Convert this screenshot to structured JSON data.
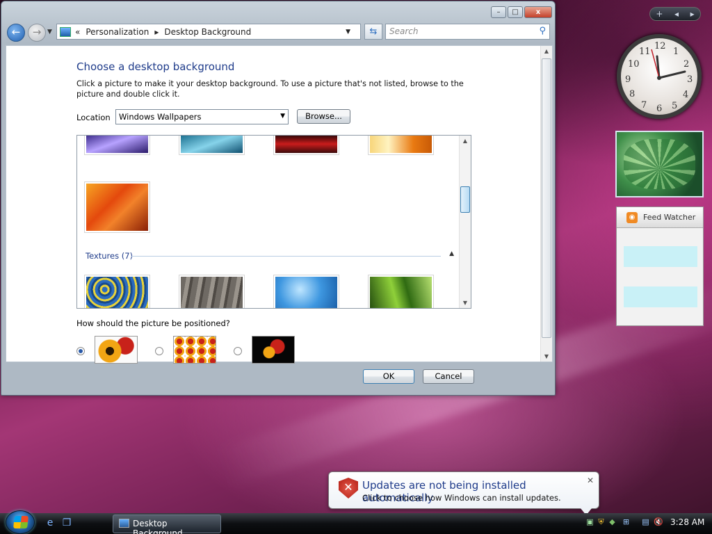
{
  "window": {
    "breadcrumb": [
      "Personalization",
      "Desktop Background"
    ],
    "breadcrumb_prefix": "«",
    "breadcrumb_sep": "▸",
    "search_placeholder": "Search",
    "caption": {
      "minimize": "–",
      "maximize": "□",
      "close": "x"
    }
  },
  "page": {
    "title": "Choose a desktop background",
    "description": "Click a picture to make it your desktop background. To use a picture that's not listed, browse to the picture and double click it.",
    "location_label": "Location",
    "location_value": "Windows Wallpapers",
    "browse_label": "Browse...",
    "section_textures": "Textures (7)",
    "position_question": "How should the picture be positioned?",
    "ok_label": "OK",
    "cancel_label": "Cancel"
  },
  "taskbar": {
    "task_label": "Desktop Background",
    "time": "3:28 AM"
  },
  "notification": {
    "title": "Updates are not being installed automatically",
    "subtitle": "Click to choose how Windows can install updates."
  },
  "sidebar": {
    "feed_title": "Feed Watcher",
    "clock_numbers": [
      "12",
      "1",
      "2",
      "3",
      "4",
      "5",
      "6",
      "7",
      "8",
      "9",
      "10",
      "11"
    ]
  },
  "colors": {
    "accent": "#1e3b8a",
    "taskbar": "#0d0f12"
  },
  "icons": [
    "back-arrow-icon",
    "forward-arrow-icon",
    "refresh-icon",
    "search-icon",
    "computer-icon",
    "rss-icon",
    "error-shield-icon",
    "windows-logo-icon"
  ]
}
